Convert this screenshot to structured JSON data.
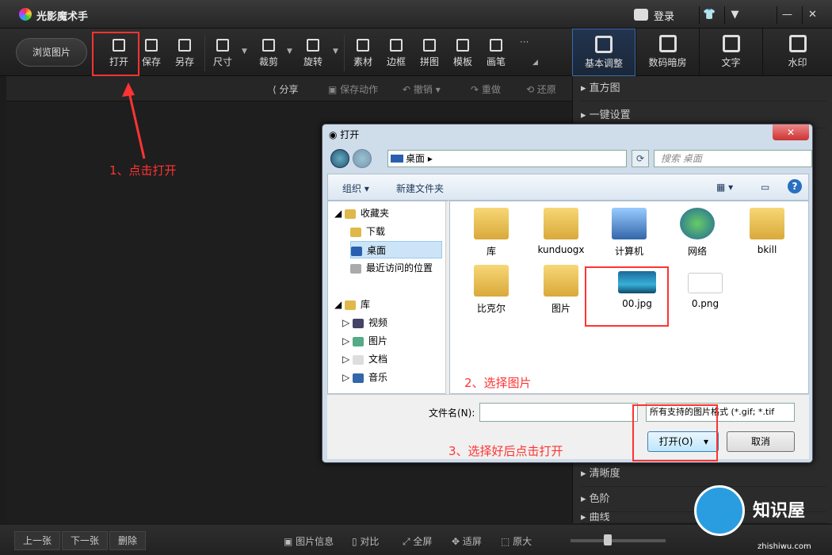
{
  "app": {
    "title": "光影魔术手",
    "login": "登录"
  },
  "window": {
    "btn_skin": "👕",
    "btn_menu": "▼",
    "btn_min": "—",
    "btn_close": "✕"
  },
  "toolbar": {
    "browse": "浏览图片",
    "tools": [
      "打开",
      "保存",
      "另存",
      "尺寸",
      "裁剪",
      "旋转",
      "素材",
      "边框",
      "拼图",
      "模板",
      "画笔"
    ],
    "right_tabs": [
      "基本调整",
      "数码暗房",
      "文字",
      "水印"
    ]
  },
  "subbar": {
    "items": [
      "分享",
      "保存动作",
      "撤销",
      "重做",
      "还原"
    ]
  },
  "right_panel": {
    "rows": [
      "直方图",
      "一键设置",
      "清晰度",
      "色阶",
      "曲线"
    ]
  },
  "bottombar": {
    "prev": "上一张",
    "next": "下一张",
    "delete": "删除",
    "items": [
      "图片信息",
      "对比",
      "全屏",
      "适屏",
      "原大"
    ]
  },
  "annotations": {
    "step1": "1、点击打开",
    "step2": "2、选择图片",
    "step3": "3、选择好后点击打开"
  },
  "dialog": {
    "title": "打开",
    "address": "桌面",
    "search_placeholder": "搜索 桌面",
    "cmd_organize": "组织 ▾",
    "cmd_newfolder": "新建文件夹",
    "nav": [
      "收藏夹",
      "下载",
      "桌面",
      "最近访问的位置",
      "库",
      "视频",
      "图片",
      "文档",
      "音乐"
    ],
    "files": [
      "库",
      "kunduogx",
      "计算机",
      "网络",
      "bkill",
      "比克尔",
      "图片",
      "00.jpg",
      "0.png"
    ],
    "filename_label": "文件名(N):",
    "filetype": "所有支持的图片格式 (*.gif; *.tif",
    "open": "打开(O)",
    "cancel": "取消"
  },
  "watermark": {
    "text": "知识屋",
    "url": "zhishiwu.com"
  }
}
